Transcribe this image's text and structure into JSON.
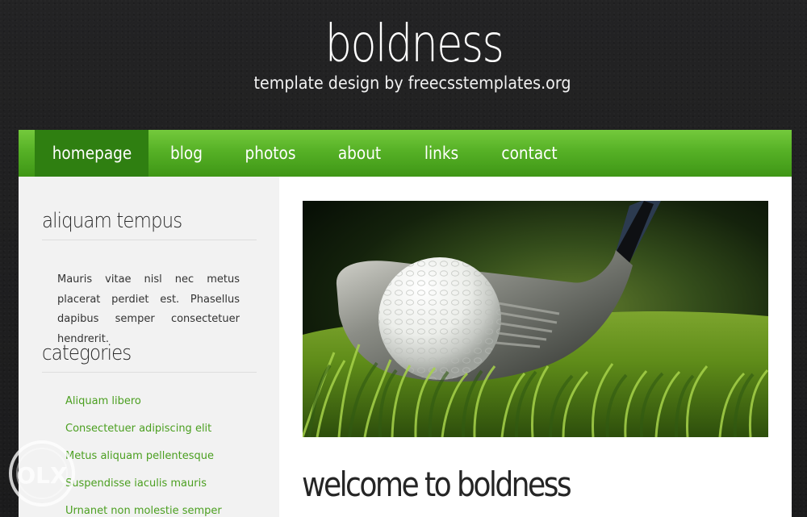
{
  "header": {
    "title": "boldness",
    "subtitle": "template design by freecsstemplates.org"
  },
  "nav": {
    "items": [
      {
        "label": "homepage",
        "active": true
      },
      {
        "label": "blog",
        "active": false
      },
      {
        "label": "photos",
        "active": false
      },
      {
        "label": "about",
        "active": false
      },
      {
        "label": "links",
        "active": false
      },
      {
        "label": "contact",
        "active": false
      }
    ]
  },
  "sidebar": {
    "intro_heading": "aliquam tempus",
    "intro_text": "Mauris vitae nisl nec metus placerat perdiet est. Phasellus dapibus semper consectetuer hendrerit.",
    "categories_heading": "categories",
    "categories": [
      "Aliquam libero",
      "Consectetuer adipiscing elit",
      "Metus aliquam pellentesque",
      "Suspendisse iaculis mauris",
      "Urnanet non molestie semper"
    ]
  },
  "main": {
    "image_subject": "golf-ball-and-club",
    "heading": "welcome to boldness"
  },
  "watermark": {
    "text": "OLX"
  },
  "colors": {
    "background": "#1f1f20",
    "nav_green": "#56b126",
    "nav_active": "#2f7f11",
    "link_green": "#4b9f20",
    "content_background": "#ffffff",
    "sidebar_background": "#f2f2f2"
  }
}
